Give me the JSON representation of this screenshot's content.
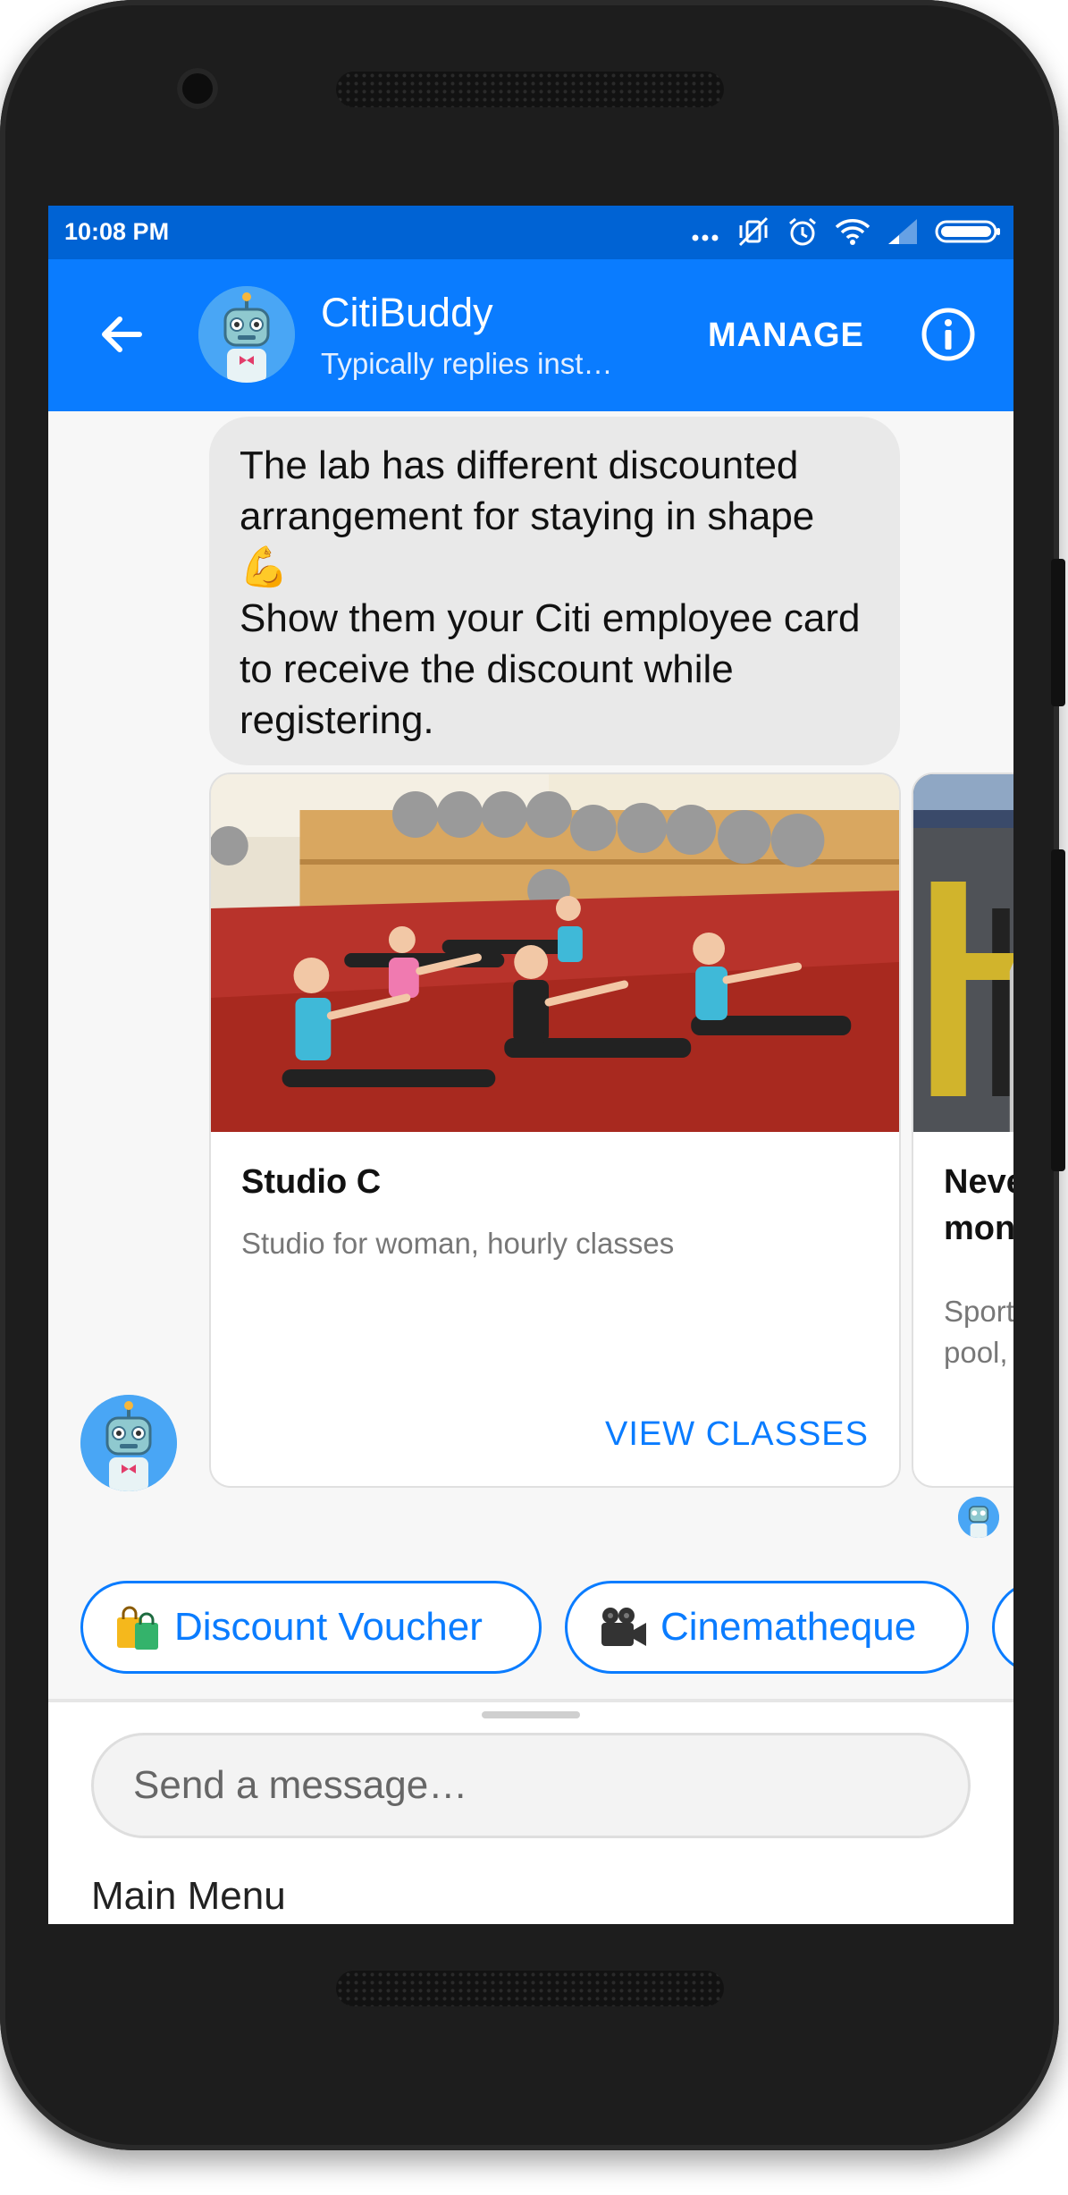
{
  "status_bar": {
    "time": "10:08 PM"
  },
  "header": {
    "title": "CitiBuddy",
    "subtitle": "Typically replies inst…",
    "manage_label": "MANAGE"
  },
  "message": {
    "text": "The lab has different discounted arrangement for staying in shape 💪\nShow them your Citi employee card to receive the discount while registering.",
    "emoji": "flexed-biceps"
  },
  "cards": [
    {
      "title": "Studio C",
      "subtitle": "Studio for woman, hourly classes",
      "action": "VIEW CLASSES"
    },
    {
      "title": "Neve\nmon",
      "subtitle": "Sport\npool,",
      "action": ""
    }
  ],
  "quick_replies": [
    {
      "label": "Discount Voucher",
      "icon": "shopping-bags-icon"
    },
    {
      "label": "Cinematheque",
      "icon": "movie-camera-icon"
    }
  ],
  "composer": {
    "placeholder": "Send a message…",
    "menu_label": "Main Menu"
  },
  "colors": {
    "accent": "#0a7cff",
    "status_bar": "#0063d4"
  }
}
